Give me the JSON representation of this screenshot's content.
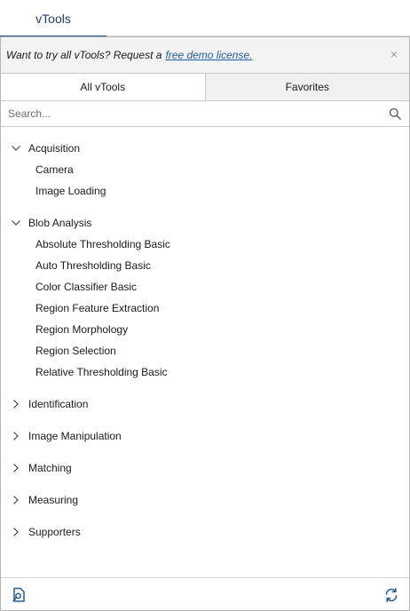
{
  "window": {
    "tab_label": "vTools"
  },
  "banner": {
    "text": "Want to try all vTools? Request a",
    "link_text": "free demo license.",
    "close_glyph": "×"
  },
  "subtabs": [
    {
      "label": "All vTools",
      "active": true
    },
    {
      "label": "Favorites",
      "active": false
    }
  ],
  "search": {
    "placeholder": "Search...",
    "value": "",
    "icon": "search-icon"
  },
  "tree": {
    "categories": [
      {
        "label": "Acquisition",
        "expanded": true,
        "items": [
          "Camera",
          "Image Loading"
        ]
      },
      {
        "label": "Blob Analysis",
        "expanded": true,
        "items": [
          "Absolute Thresholding Basic",
          "Auto Thresholding Basic",
          "Color Classifier Basic",
          "Region Feature Extraction",
          "Region Morphology",
          "Region Selection",
          "Relative Thresholding Basic"
        ]
      },
      {
        "label": "Identification",
        "expanded": false,
        "items": []
      },
      {
        "label": "Image Manipulation",
        "expanded": false,
        "items": []
      },
      {
        "label": "Matching",
        "expanded": false,
        "items": []
      },
      {
        "label": "Measuring",
        "expanded": false,
        "items": []
      },
      {
        "label": "Supporters",
        "expanded": false,
        "items": []
      }
    ]
  },
  "footer": {
    "left_icon": "document-search-icon",
    "right_icon": "refresh-icon"
  },
  "colors": {
    "accent": "#1f4e8c",
    "link": "#1f5b9e",
    "banner_bg": "#f3f3f3",
    "tab_inactive_bg": "#f0f0f0",
    "icon_blue": "#2a5a8f"
  }
}
